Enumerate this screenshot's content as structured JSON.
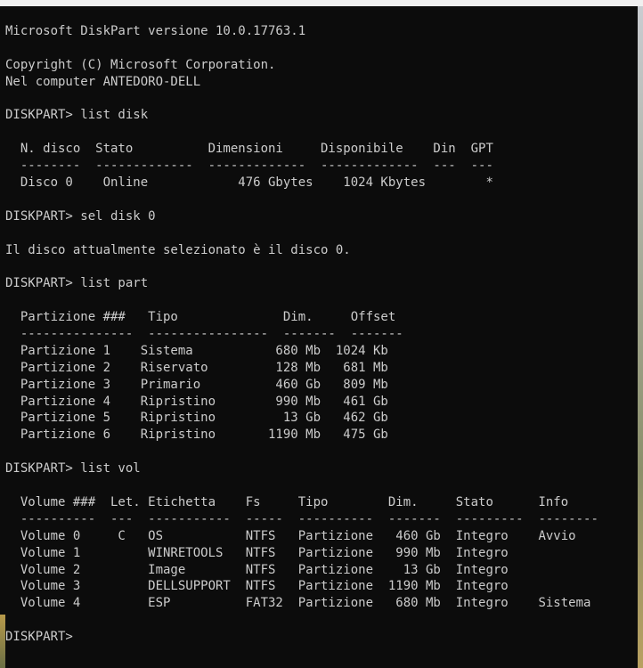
{
  "lines": [
    "Microsoft DiskPart versione 10.0.17763.1",
    "",
    "Copyright (C) Microsoft Corporation.",
    "Nel computer ANTEDORO-DELL",
    "",
    "DISKPART> list disk",
    "",
    "  N. disco  Stato          Dimensioni     Disponibile    Din  GPT",
    "  --------  -------------  -------------  -------------  ---  ---",
    "  Disco 0    Online            476 Gbytes    1024 Kbytes        *",
    "",
    "DISKPART> sel disk 0",
    "",
    "Il disco attualmente selezionato è il disco 0.",
    "",
    "DISKPART> list part",
    "",
    "  Partizione ###   Tipo              Dim.     Offset",
    "  ---------------  ----------------  -------  -------",
    "  Partizione 1    Sistema           680 Mb  1024 Kb",
    "  Partizione 2    Riservato         128 Mb   681 Mb",
    "  Partizione 3    Primario          460 Gb   809 Mb",
    "  Partizione 4    Ripristino        990 Mb   461 Gb",
    "  Partizione 5    Ripristino         13 Gb   462 Gb",
    "  Partizione 6    Ripristino       1190 Mb   475 Gb",
    "",
    "DISKPART> list vol",
    "",
    "  Volume ###  Let. Etichetta    Fs     Tipo        Dim.     Stato      Info",
    "  ----------  ---  -----------  -----  ----------  -------  ---------  --------",
    "  Volume 0     C   OS           NTFS   Partizione   460 Gb  Integro    Avvio",
    "  Volume 1         WINRETOOLS   NTFS   Partizione   990 Mb  Integro",
    "  Volume 2         Image        NTFS   Partizione    13 Gb  Integro",
    "  Volume 3         DELLSUPPORT  NTFS   Partizione  1190 Mb  Integro",
    "  Volume 4         ESP          FAT32  Partizione   680 Mb  Integro    Sistema",
    "",
    "DISKPART> "
  ]
}
